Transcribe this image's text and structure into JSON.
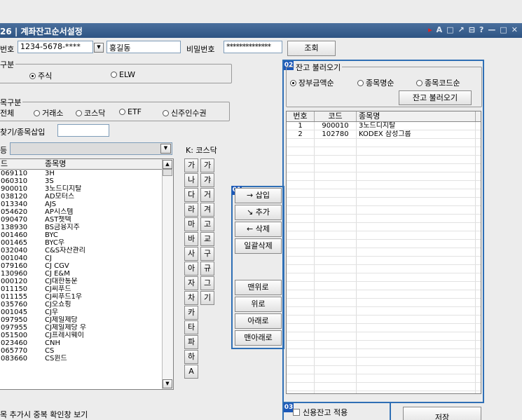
{
  "title": "26 | 계좌잔고순서설정",
  "title_icons": [
    "▸",
    "A",
    "□",
    "↗",
    "⊟",
    "?",
    "—",
    "□",
    "✕"
  ],
  "account": {
    "label": "번호",
    "number": "1234-5678-****",
    "name": "홍길동",
    "password_label": "비밀번호",
    "password": "**************",
    "search_button": "조회"
  },
  "asset_type": {
    "legend": "구분",
    "options": [
      {
        "label": "주식",
        "selected": true
      },
      {
        "label": "ELW",
        "selected": false
      }
    ]
  },
  "item_type": {
    "legend": "목구분",
    "options": [
      {
        "label": "전체",
        "selected": false
      },
      {
        "label": "거래소",
        "selected": false
      },
      {
        "label": "코스닥",
        "selected": false
      },
      {
        "label": "ETF",
        "selected": false
      },
      {
        "label": "신주인수권",
        "selected": false
      }
    ],
    "search_label": "찾기/종목삽입",
    "search_value": "",
    "group_label": "등",
    "group_value": "",
    "market_hint": "K: 코스닥"
  },
  "stock_list": {
    "headers": [
      "드",
      "종목명"
    ],
    "rows": [
      [
        "069110",
        "3H"
      ],
      [
        "060310",
        "3S"
      ],
      [
        "900010",
        "3노드디지탈"
      ],
      [
        "038120",
        "AD모터스"
      ],
      [
        "013340",
        "AJS"
      ],
      [
        "054620",
        "AP시스템"
      ],
      [
        "090470",
        "AST젯텍"
      ],
      [
        "138930",
        "BS금융지주"
      ],
      [
        "001460",
        "BYC"
      ],
      [
        "001465",
        "BYC우"
      ],
      [
        "032040",
        "C&S자산관리"
      ],
      [
        "001040",
        "CJ"
      ],
      [
        "079160",
        "CJ CGV"
      ],
      [
        "130960",
        "CJ E&M"
      ],
      [
        "000120",
        "CJ대한통운"
      ],
      [
        "011150",
        "CJ씨푸드"
      ],
      [
        "011155",
        "CJ씨푸드1우"
      ],
      [
        "035760",
        "CJ오쇼핑"
      ],
      [
        "001045",
        "CJ우"
      ],
      [
        "097950",
        "CJ제일제당"
      ],
      [
        "097955",
        "CJ제일제당 우"
      ],
      [
        "051500",
        "CJ프레시웨이"
      ],
      [
        "023460",
        "CNH"
      ],
      [
        "065770",
        "CS"
      ],
      [
        "083660",
        "CS윈드"
      ]
    ]
  },
  "consonants": {
    "left": [
      "가",
      "나",
      "다",
      "라",
      "마",
      "바",
      "사",
      "아",
      "자",
      "차",
      "카",
      "타",
      "파",
      "하",
      "A"
    ],
    "right": [
      "가",
      "갸",
      "거",
      "겨",
      "고",
      "교",
      "구",
      "규",
      "그",
      "기"
    ]
  },
  "actions": {
    "tag": "01",
    "insert": "→ 삽입",
    "add": "↘ 추가",
    "delete": "← 삭제",
    "delete_all": "일괄삭제",
    "top": "맨위로",
    "up": "위로",
    "down": "아래로",
    "bottom": "맨아래로"
  },
  "balance_load": {
    "tag": "02",
    "legend": "잔고 불러오기",
    "options": [
      {
        "label": "장부금액순",
        "selected": true
      },
      {
        "label": "종목명순",
        "selected": false
      },
      {
        "label": "종목코드순",
        "selected": false
      }
    ],
    "button": "잔고 불러오기"
  },
  "balance_list": {
    "headers": [
      "번호",
      "코드",
      "종목명"
    ],
    "rows": [
      [
        "1",
        "900010",
        "3노드디지탈"
      ],
      [
        "2",
        "102780",
        "KODEX 삼성그룹"
      ]
    ]
  },
  "footer": {
    "tag": "03",
    "credit_label": "신용잔고 적용",
    "save_button": "저장",
    "check_label": "목 추가시 중복 확인창 보기"
  }
}
